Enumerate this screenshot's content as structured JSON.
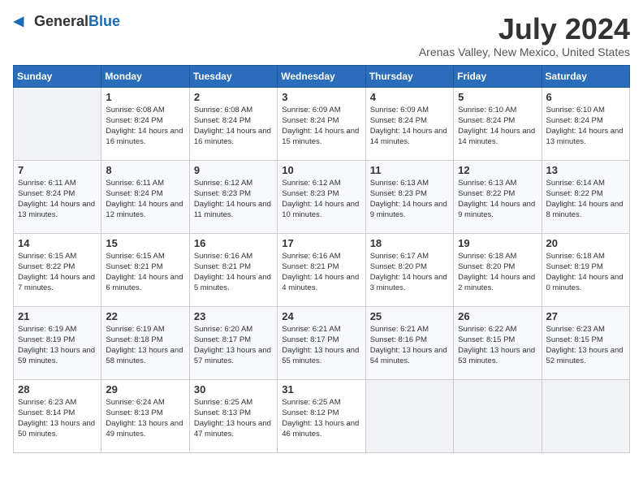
{
  "logo": {
    "text_general": "General",
    "text_blue": "Blue"
  },
  "title": {
    "month_year": "July 2024",
    "location": "Arenas Valley, New Mexico, United States"
  },
  "days_of_week": [
    "Sunday",
    "Monday",
    "Tuesday",
    "Wednesday",
    "Thursday",
    "Friday",
    "Saturday"
  ],
  "weeks": [
    [
      {
        "day": "",
        "info": ""
      },
      {
        "day": "1",
        "info": "Sunrise: 6:08 AM\nSunset: 8:24 PM\nDaylight: 14 hours and 16 minutes."
      },
      {
        "day": "2",
        "info": "Sunrise: 6:08 AM\nSunset: 8:24 PM\nDaylight: 14 hours and 16 minutes."
      },
      {
        "day": "3",
        "info": "Sunrise: 6:09 AM\nSunset: 8:24 PM\nDaylight: 14 hours and 15 minutes."
      },
      {
        "day": "4",
        "info": "Sunrise: 6:09 AM\nSunset: 8:24 PM\nDaylight: 14 hours and 14 minutes."
      },
      {
        "day": "5",
        "info": "Sunrise: 6:10 AM\nSunset: 8:24 PM\nDaylight: 14 hours and 14 minutes."
      },
      {
        "day": "6",
        "info": "Sunrise: 6:10 AM\nSunset: 8:24 PM\nDaylight: 14 hours and 13 minutes."
      }
    ],
    [
      {
        "day": "7",
        "info": "Sunrise: 6:11 AM\nSunset: 8:24 PM\nDaylight: 14 hours and 13 minutes."
      },
      {
        "day": "8",
        "info": "Sunrise: 6:11 AM\nSunset: 8:24 PM\nDaylight: 14 hours and 12 minutes."
      },
      {
        "day": "9",
        "info": "Sunrise: 6:12 AM\nSunset: 8:23 PM\nDaylight: 14 hours and 11 minutes."
      },
      {
        "day": "10",
        "info": "Sunrise: 6:12 AM\nSunset: 8:23 PM\nDaylight: 14 hours and 10 minutes."
      },
      {
        "day": "11",
        "info": "Sunrise: 6:13 AM\nSunset: 8:23 PM\nDaylight: 14 hours and 9 minutes."
      },
      {
        "day": "12",
        "info": "Sunrise: 6:13 AM\nSunset: 8:22 PM\nDaylight: 14 hours and 9 minutes."
      },
      {
        "day": "13",
        "info": "Sunrise: 6:14 AM\nSunset: 8:22 PM\nDaylight: 14 hours and 8 minutes."
      }
    ],
    [
      {
        "day": "14",
        "info": "Sunrise: 6:15 AM\nSunset: 8:22 PM\nDaylight: 14 hours and 7 minutes."
      },
      {
        "day": "15",
        "info": "Sunrise: 6:15 AM\nSunset: 8:21 PM\nDaylight: 14 hours and 6 minutes."
      },
      {
        "day": "16",
        "info": "Sunrise: 6:16 AM\nSunset: 8:21 PM\nDaylight: 14 hours and 5 minutes."
      },
      {
        "day": "17",
        "info": "Sunrise: 6:16 AM\nSunset: 8:21 PM\nDaylight: 14 hours and 4 minutes."
      },
      {
        "day": "18",
        "info": "Sunrise: 6:17 AM\nSunset: 8:20 PM\nDaylight: 14 hours and 3 minutes."
      },
      {
        "day": "19",
        "info": "Sunrise: 6:18 AM\nSunset: 8:20 PM\nDaylight: 14 hours and 2 minutes."
      },
      {
        "day": "20",
        "info": "Sunrise: 6:18 AM\nSunset: 8:19 PM\nDaylight: 14 hours and 0 minutes."
      }
    ],
    [
      {
        "day": "21",
        "info": "Sunrise: 6:19 AM\nSunset: 8:19 PM\nDaylight: 13 hours and 59 minutes."
      },
      {
        "day": "22",
        "info": "Sunrise: 6:19 AM\nSunset: 8:18 PM\nDaylight: 13 hours and 58 minutes."
      },
      {
        "day": "23",
        "info": "Sunrise: 6:20 AM\nSunset: 8:17 PM\nDaylight: 13 hours and 57 minutes."
      },
      {
        "day": "24",
        "info": "Sunrise: 6:21 AM\nSunset: 8:17 PM\nDaylight: 13 hours and 55 minutes."
      },
      {
        "day": "25",
        "info": "Sunrise: 6:21 AM\nSunset: 8:16 PM\nDaylight: 13 hours and 54 minutes."
      },
      {
        "day": "26",
        "info": "Sunrise: 6:22 AM\nSunset: 8:15 PM\nDaylight: 13 hours and 53 minutes."
      },
      {
        "day": "27",
        "info": "Sunrise: 6:23 AM\nSunset: 8:15 PM\nDaylight: 13 hours and 52 minutes."
      }
    ],
    [
      {
        "day": "28",
        "info": "Sunrise: 6:23 AM\nSunset: 8:14 PM\nDaylight: 13 hours and 50 minutes."
      },
      {
        "day": "29",
        "info": "Sunrise: 6:24 AM\nSunset: 8:13 PM\nDaylight: 13 hours and 49 minutes."
      },
      {
        "day": "30",
        "info": "Sunrise: 6:25 AM\nSunset: 8:13 PM\nDaylight: 13 hours and 47 minutes."
      },
      {
        "day": "31",
        "info": "Sunrise: 6:25 AM\nSunset: 8:12 PM\nDaylight: 13 hours and 46 minutes."
      },
      {
        "day": "",
        "info": ""
      },
      {
        "day": "",
        "info": ""
      },
      {
        "day": "",
        "info": ""
      }
    ]
  ]
}
